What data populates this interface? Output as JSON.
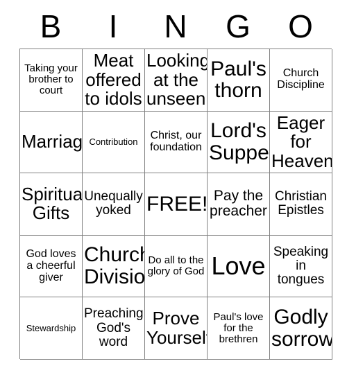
{
  "header": {
    "letters": [
      "B",
      "I",
      "N",
      "G",
      "O"
    ]
  },
  "grid": {
    "columns": 5,
    "rows": 5,
    "border_color": "#808080",
    "cell_background": "#ffffff",
    "text_color": "#000000",
    "cells": [
      {
        "text": "Taking your brother to court",
        "size": "fs-s"
      },
      {
        "text": "Meat offered to idols",
        "size": "fs-xl"
      },
      {
        "text": "Looking at the unseen",
        "size": "fs-xl"
      },
      {
        "text": "Paul's thorn",
        "size": "fs-xxl"
      },
      {
        "text": "Church Discipline",
        "size": "fs-sm"
      },
      {
        "text": "Marriage",
        "size": "fs-xl"
      },
      {
        "text": "Contribution",
        "size": "fs-xs"
      },
      {
        "text": "Christ, our foundation",
        "size": "fs-sm"
      },
      {
        "text": "Lord's Supper",
        "size": "fs-xxl"
      },
      {
        "text": "Eager for Heaven",
        "size": "fs-xl"
      },
      {
        "text": "Spiritual Gifts",
        "size": "fs-xl"
      },
      {
        "text": "Unequally yoked",
        "size": "fs-m"
      },
      {
        "text": "FREE!",
        "size": "fs-xxl"
      },
      {
        "text": "Pay the preacher",
        "size": "fs-ml"
      },
      {
        "text": "Christian Epistles",
        "size": "fs-m"
      },
      {
        "text": "God loves a cheerful giver",
        "size": "fs-sm"
      },
      {
        "text": "Church Division",
        "size": "fs-xxl"
      },
      {
        "text": "Do all to the glory of God",
        "size": "fs-s"
      },
      {
        "text": "Love",
        "size": "fs-huge"
      },
      {
        "text": "Speaking in tongues",
        "size": "fs-m"
      },
      {
        "text": "Stewardship",
        "size": "fs-xs"
      },
      {
        "text": "Preaching God's word",
        "size": "fs-m"
      },
      {
        "text": "Prove Yourself",
        "size": "fs-xl"
      },
      {
        "text": "Paul's love for the brethren",
        "size": "fs-s"
      },
      {
        "text": "Godly sorrow",
        "size": "fs-xxl"
      }
    ]
  }
}
